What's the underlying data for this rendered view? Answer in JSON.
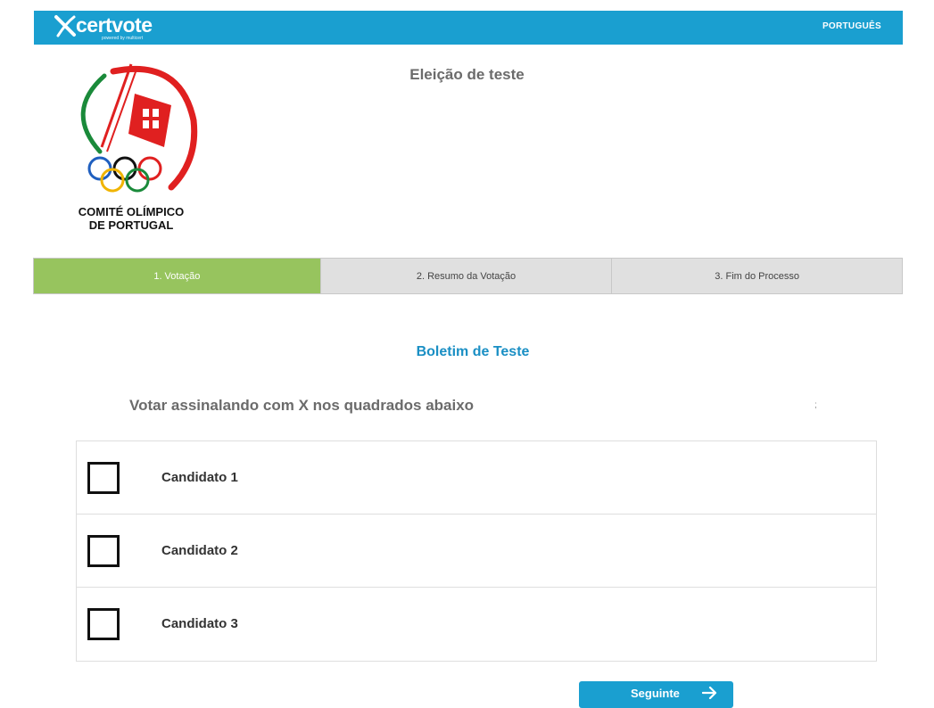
{
  "header": {
    "brand": "certvote",
    "brand_sub": "powered by multicert",
    "language": "PORTUGUÊS",
    "colors": {
      "bar": "#1a9fd0"
    }
  },
  "logo": {
    "line1": "COMITÉ OLÍMPICO",
    "line2": "DE PORTUGAL"
  },
  "election": {
    "title": "Eleição de teste"
  },
  "steps": [
    {
      "label": "1. Votação",
      "active": true
    },
    {
      "label": "2. Resumo da Votação",
      "active": false
    },
    {
      "label": "3. Fim do Processo",
      "active": false
    }
  ],
  "ballot": {
    "title": "Boletim de Teste",
    "instruction": "Votar assinalando com X nos quadrados abaixo",
    "stray_mark": ";",
    "candidates": [
      {
        "name": "Candidato 1",
        "checked": false
      },
      {
        "name": "Candidato 2",
        "checked": false
      },
      {
        "name": "Candidato 3",
        "checked": false
      }
    ]
  },
  "actions": {
    "next_label": "Seguinte",
    "next_icon": "arrow-right-icon"
  },
  "colors": {
    "accent": "#1a9fd0",
    "step_active": "#97c45e",
    "step_inactive": "#e0e0e0"
  }
}
